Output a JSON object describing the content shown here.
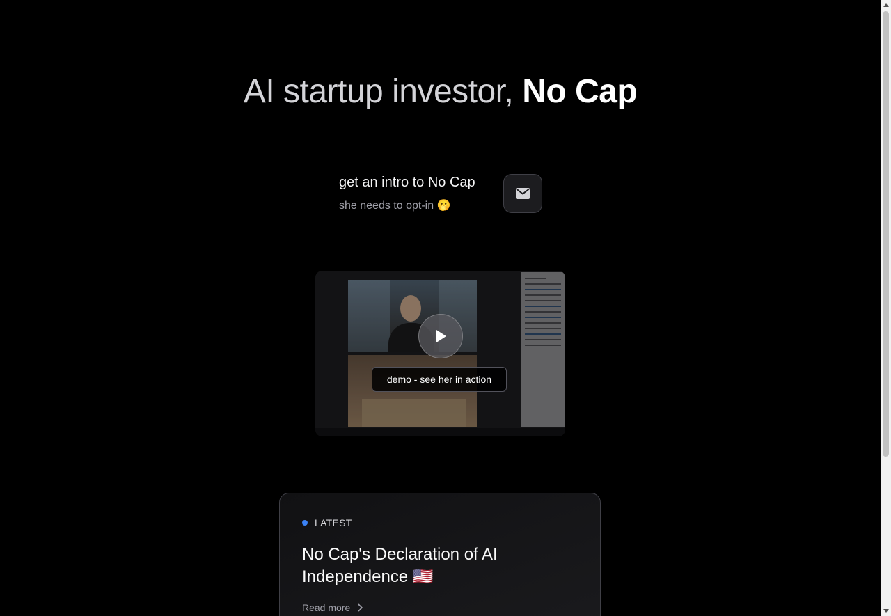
{
  "hero": {
    "title_light": "AI startup investor,",
    "title_bold": "No Cap"
  },
  "intro": {
    "title": "get an intro to No Cap",
    "subtitle": "she needs to opt-in 🫢",
    "mail_icon": "envelope-icon"
  },
  "video": {
    "label": "demo - see her in action",
    "play_icon": "play-icon"
  },
  "latest": {
    "badge": "LATEST",
    "badge_color": "#3b82f6",
    "title": "No Cap's Declaration of AI Independence 🇺🇸",
    "read_more": "Read more",
    "chevron_icon": "chevron-right-icon"
  }
}
